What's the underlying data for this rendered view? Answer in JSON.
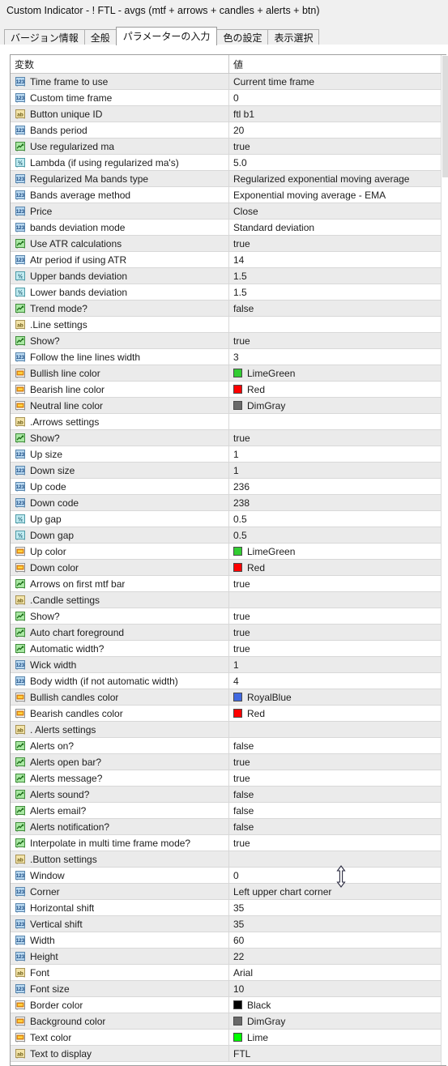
{
  "window": {
    "title": "Custom Indicator - ! FTL - avgs (mtf + arrows + candles + alerts + btn)"
  },
  "tabs": [
    {
      "label": "バージョン情報",
      "active": false
    },
    {
      "label": "全般",
      "active": false
    },
    {
      "label": "パラメーターの入力",
      "active": true
    },
    {
      "label": "色の設定",
      "active": false
    },
    {
      "label": "表示選択",
      "active": false
    }
  ],
  "table": {
    "headers": {
      "variable": "変数",
      "value": "値"
    },
    "rows": [
      {
        "icon": "int-icon",
        "name": "Time frame to use",
        "value": "Current time frame"
      },
      {
        "icon": "int-icon",
        "name": "Custom time frame",
        "value": "0"
      },
      {
        "icon": "string-icon",
        "name": "Button unique ID",
        "value": "ftl b1"
      },
      {
        "icon": "int-icon",
        "name": "Bands period",
        "value": "20"
      },
      {
        "icon": "bool-icon",
        "name": "Use regularized ma",
        "value": "true"
      },
      {
        "icon": "float-icon",
        "name": "Lambda (if using regularized ma's)",
        "value": "5.0"
      },
      {
        "icon": "int-icon",
        "name": "Regularized Ma bands type",
        "value": "Regularized exponential moving average"
      },
      {
        "icon": "int-icon",
        "name": "Bands average method",
        "value": "Exponential moving average - EMA"
      },
      {
        "icon": "int-icon",
        "name": "Price",
        "value": "Close"
      },
      {
        "icon": "int-icon",
        "name": "bands deviation mode",
        "value": "Standard deviation"
      },
      {
        "icon": "bool-icon",
        "name": "Use ATR calculations",
        "value": "true"
      },
      {
        "icon": "int-icon",
        "name": "Atr period if using ATR",
        "value": "14"
      },
      {
        "icon": "float-icon",
        "name": "Upper bands deviation",
        "value": "1.5"
      },
      {
        "icon": "float-icon",
        "name": "Lower bands deviation",
        "value": "1.5"
      },
      {
        "icon": "bool-icon",
        "name": "Trend mode?",
        "value": "false"
      },
      {
        "icon": "string-icon",
        "name": ".Line settings",
        "value": ""
      },
      {
        "icon": "bool-icon",
        "name": "Show?",
        "value": "true"
      },
      {
        "icon": "int-icon",
        "name": "Follow the line lines width",
        "value": "3"
      },
      {
        "icon": "color-icon",
        "name": "Bullish line color",
        "value": "LimeGreen",
        "swatch": "#32cd32"
      },
      {
        "icon": "color-icon",
        "name": "Bearish line color",
        "value": "Red",
        "swatch": "#ff0000"
      },
      {
        "icon": "color-icon",
        "name": "Neutral line color",
        "value": "DimGray",
        "swatch": "#696969"
      },
      {
        "icon": "string-icon",
        "name": ".Arrows settings",
        "value": ""
      },
      {
        "icon": "bool-icon",
        "name": "Show?",
        "value": "true"
      },
      {
        "icon": "int-icon",
        "name": "Up size",
        "value": "1"
      },
      {
        "icon": "int-icon",
        "name": "Down size",
        "value": "1"
      },
      {
        "icon": "int-icon",
        "name": "Up code",
        "value": "236"
      },
      {
        "icon": "int-icon",
        "name": "Down code",
        "value": "238"
      },
      {
        "icon": "float-icon",
        "name": "Up gap",
        "value": "0.5"
      },
      {
        "icon": "float-icon",
        "name": "Down gap",
        "value": "0.5"
      },
      {
        "icon": "color-icon",
        "name": "Up color",
        "value": "LimeGreen",
        "swatch": "#32cd32"
      },
      {
        "icon": "color-icon",
        "name": "Down color",
        "value": "Red",
        "swatch": "#ff0000"
      },
      {
        "icon": "bool-icon",
        "name": "Arrows on first mtf bar",
        "value": "true"
      },
      {
        "icon": "string-icon",
        "name": ".Candle settings",
        "value": ""
      },
      {
        "icon": "bool-icon",
        "name": "Show?",
        "value": "true"
      },
      {
        "icon": "bool-icon",
        "name": "Auto chart foreground",
        "value": "true"
      },
      {
        "icon": "bool-icon",
        "name": "Automatic width?",
        "value": "true"
      },
      {
        "icon": "int-icon",
        "name": "Wick width",
        "value": "1"
      },
      {
        "icon": "int-icon",
        "name": "Body width (if not automatic width)",
        "value": "4"
      },
      {
        "icon": "color-icon",
        "name": "Bullish candles color",
        "value": "RoyalBlue",
        "swatch": "#4169e1"
      },
      {
        "icon": "color-icon",
        "name": "Bearish candles color",
        "value": "Red",
        "swatch": "#ff0000"
      },
      {
        "icon": "string-icon",
        "name": ". Alerts settings",
        "value": ""
      },
      {
        "icon": "bool-icon",
        "name": "Alerts on?",
        "value": "false"
      },
      {
        "icon": "bool-icon",
        "name": "Alerts open bar?",
        "value": "true"
      },
      {
        "icon": "bool-icon",
        "name": "Alerts message?",
        "value": "true"
      },
      {
        "icon": "bool-icon",
        "name": "Alerts sound?",
        "value": "false"
      },
      {
        "icon": "bool-icon",
        "name": "Alerts email?",
        "value": "false"
      },
      {
        "icon": "bool-icon",
        "name": "Alerts notification?",
        "value": "false"
      },
      {
        "icon": "bool-icon",
        "name": "Interpolate in multi time frame mode?",
        "value": "true"
      },
      {
        "icon": "string-icon",
        "name": ".Button settings",
        "value": ""
      },
      {
        "icon": "int-icon",
        "name": "Window",
        "value": "0"
      },
      {
        "icon": "int-icon",
        "name": "Corner",
        "value": "Left upper chart corner"
      },
      {
        "icon": "int-icon",
        "name": "Horizontal shift",
        "value": "35"
      },
      {
        "icon": "int-icon",
        "name": "Vertical shift",
        "value": "35"
      },
      {
        "icon": "int-icon",
        "name": "Width",
        "value": "60"
      },
      {
        "icon": "int-icon",
        "name": "Height",
        "value": "22"
      },
      {
        "icon": "string-icon",
        "name": "Font",
        "value": "Arial"
      },
      {
        "icon": "int-icon",
        "name": "Font size",
        "value": "10"
      },
      {
        "icon": "color-icon",
        "name": "Border color",
        "value": "Black",
        "swatch": "#000000"
      },
      {
        "icon": "color-icon",
        "name": "Background color",
        "value": "DimGray",
        "swatch": "#696969"
      },
      {
        "icon": "color-icon",
        "name": "Text color",
        "value": "Lime",
        "swatch": "#00ff00"
      },
      {
        "icon": "string-icon",
        "name": "Text to display",
        "value": "FTL"
      }
    ]
  },
  "cursor": {
    "type": "vertical-resize-cursor"
  }
}
